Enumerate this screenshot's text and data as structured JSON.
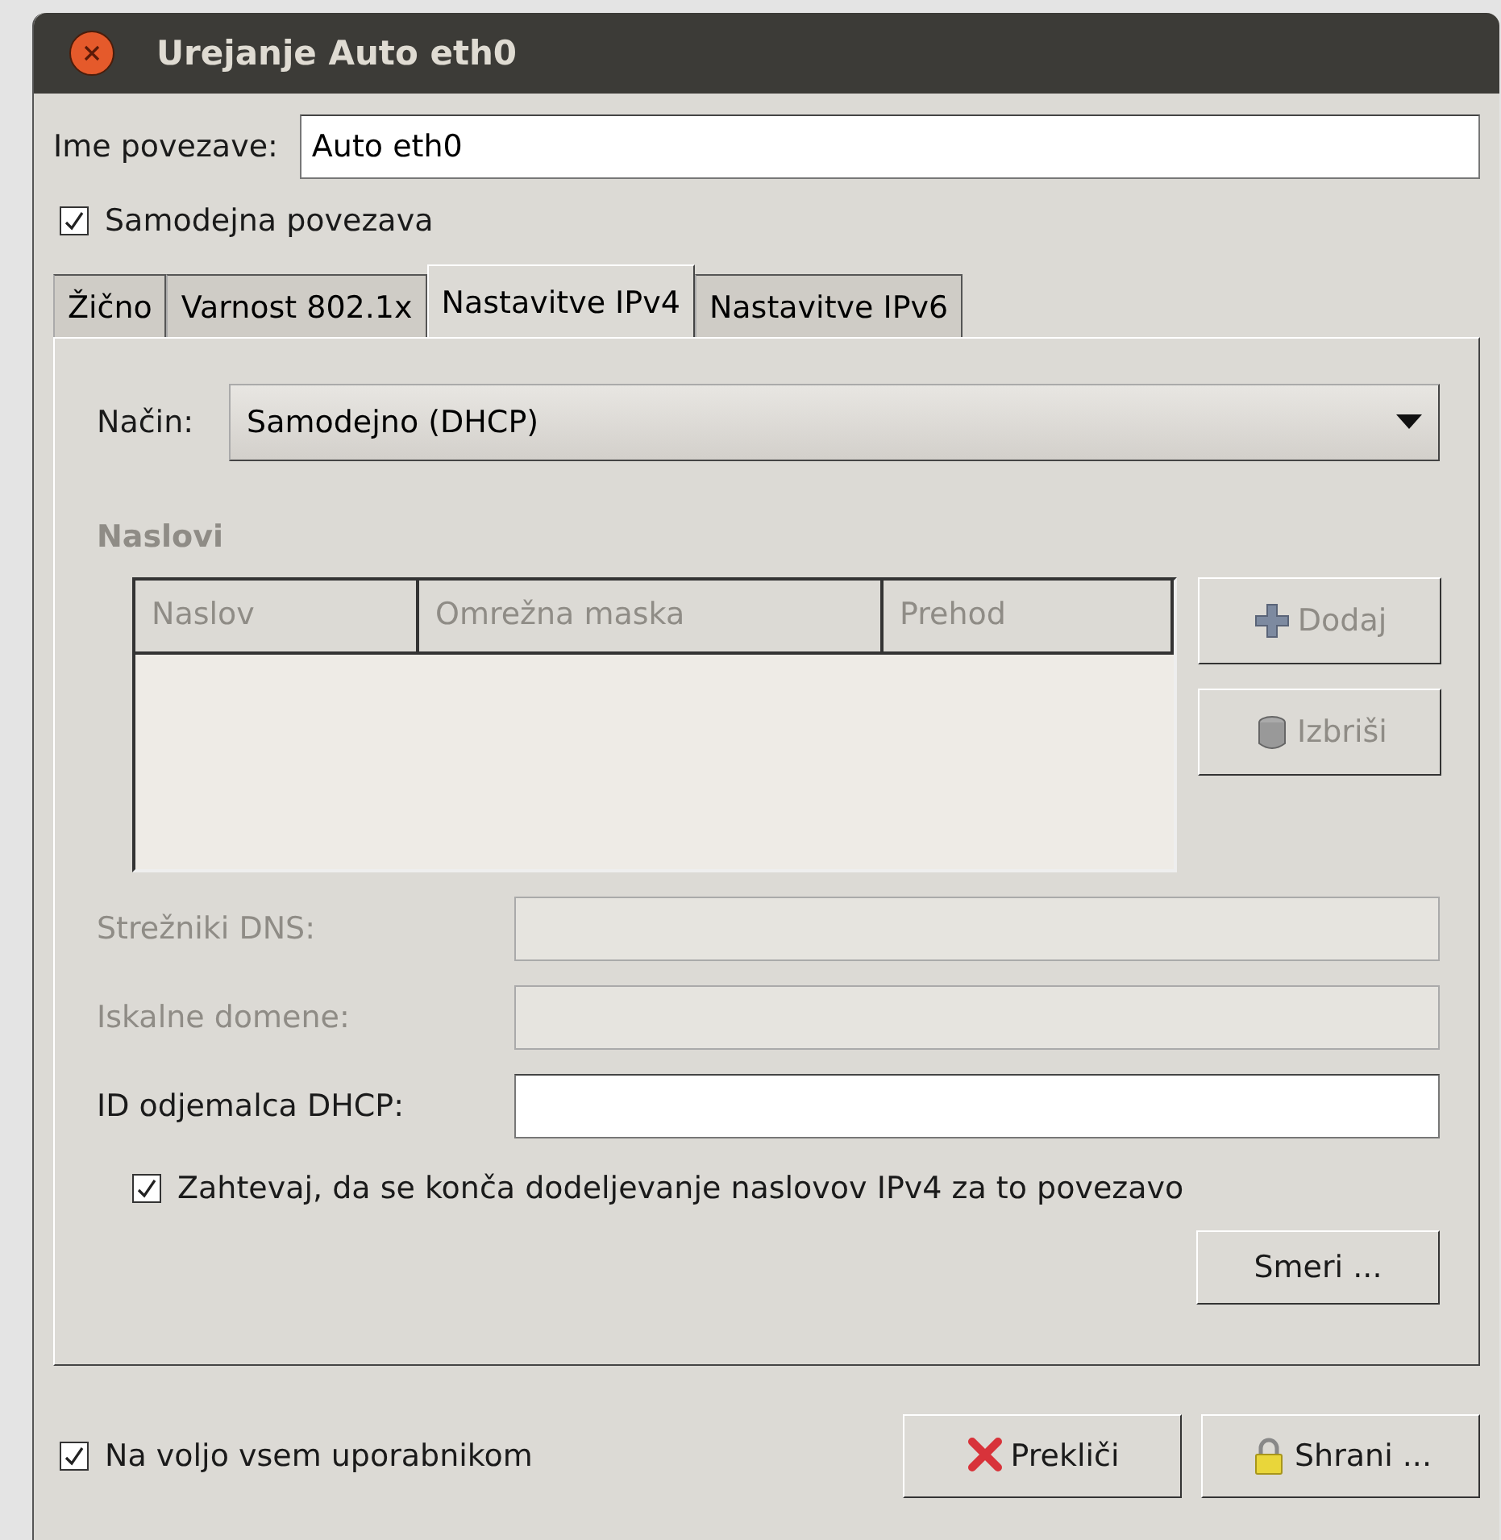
{
  "window": {
    "title": "Urejanje Auto eth0"
  },
  "connection_name": {
    "label": "Ime povezave:",
    "value": "Auto eth0"
  },
  "connect_automatically": {
    "label": "Samodejna povezava",
    "checked": true
  },
  "tabs": [
    {
      "label": "Žično",
      "selected": false
    },
    {
      "label": "Varnost 802.1x",
      "selected": false
    },
    {
      "label": "Nastavitve IPv4",
      "selected": true
    },
    {
      "label": "Nastavitve IPv6",
      "selected": false
    }
  ],
  "ipv4": {
    "method": {
      "label": "Način:",
      "value": "Samodejno (DHCP)"
    },
    "addresses": {
      "title": "Naslovi",
      "disabled": true,
      "columns": [
        "Naslov",
        "Omrežna maska",
        "Prehod"
      ],
      "buttons": [
        {
          "label": "Dodaj",
          "kind": "add",
          "disabled": true
        },
        {
          "label": "Izbriši",
          "kind": "delete",
          "disabled": true
        }
      ]
    },
    "fields": [
      {
        "label": "Strežniki DNS:",
        "disabled": true
      },
      {
        "label": "Iskalne domene:",
        "disabled": true
      },
      {
        "label": "ID odjemalca DHCP:",
        "disabled": false
      }
    ],
    "require_ipv4": {
      "label": "Zahtevaj, da se konča dodeljevanje naslovov IPv4 za to povezavo",
      "checked": true
    },
    "routes_button": {
      "label": "Smeri ..."
    }
  },
  "available_to_all": {
    "label": "Na voljo vsem uporabnikom",
    "checked": true
  },
  "buttons": [
    {
      "label": "Prekliči",
      "kind": "cancel"
    },
    {
      "label": "Shrani ...",
      "kind": "save"
    }
  ]
}
